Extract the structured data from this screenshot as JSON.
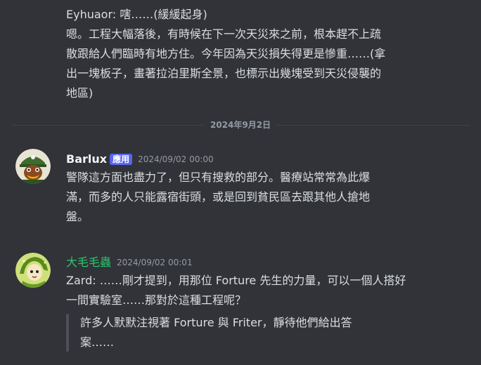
{
  "messages": [
    {
      "lines": [
        "Eyhuaor: 嗐……(緩緩起身)",
        "嗯。工程大幅落後，有時候在下一次天災來之前，根本趕不上疏",
        "散跟給人們臨時有地方住。今年因為天災損失得更是慘重……(拿",
        "出一塊板子，畫著拉泊里斯全景，也標示出幾塊受到天災侵襲的",
        "地區)"
      ]
    },
    {
      "username": "Barlux",
      "username_color": "#f2f3f5",
      "badge": "應用",
      "timestamp": "2024/09/02 00:00",
      "avatar_icon": "duck-soldier-avatar",
      "lines": [
        "警隊這方面也盡力了，但只有搜救的部分。醫療站常常為此爆",
        "滿，而多的人只能露宿街頭，或是回到貧民區去跟其他人搶地",
        "盤。"
      ]
    },
    {
      "username": "大毛毛蟲",
      "username_color": "#2dc770",
      "timestamp": "2024/09/02 00:01",
      "avatar_icon": "green-caterpillar-avatar",
      "lines": [
        "Zard: ……剛才提到，用那位 Forture 先生的力量，可以一個人搭好",
        "一間實驗室……那對於這種工程呢？"
      ],
      "quote_lines": [
        "許多人默默注視著 Forture 與 Friter，靜待他們給出答",
        "案……"
      ]
    }
  ],
  "divider": {
    "date": "2024年9月2日"
  },
  "colors": {
    "background": "#313338",
    "text": "#dbdee1",
    "muted": "#949ba4",
    "badge": "#5865f2"
  }
}
